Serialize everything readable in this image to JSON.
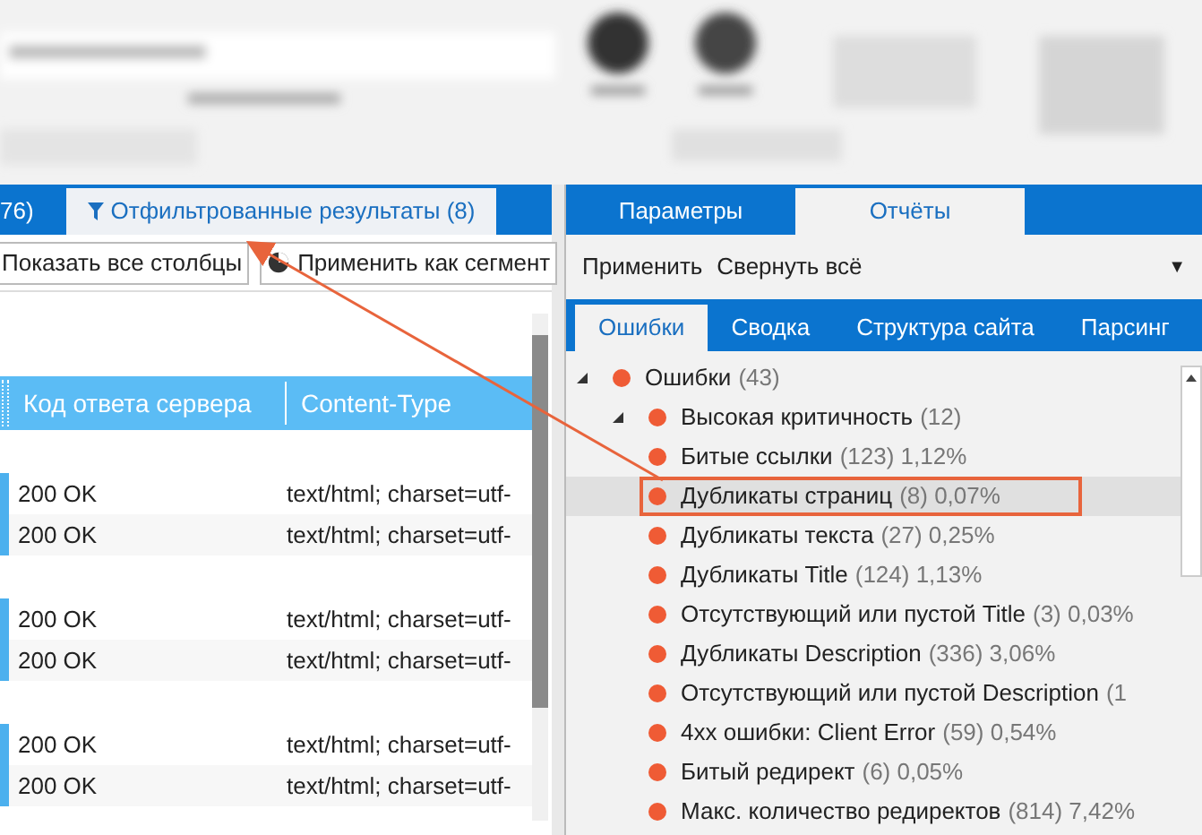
{
  "left_tabs": [
    {
      "label": "76)",
      "selected": false,
      "icon": false
    },
    {
      "label": "Отфильтрованные результаты (8)",
      "selected": true,
      "icon": true
    }
  ],
  "left_toolbar": [
    {
      "label": "Показать все столбцы",
      "icon": false
    },
    {
      "label": "Применить как сегмент",
      "icon": true
    }
  ],
  "table": {
    "columns": [
      "Код ответа сервера",
      "Content-Type"
    ],
    "groups": [
      [
        [
          "200 OK",
          "text/html; charset=utf-"
        ],
        [
          "200 OK",
          "text/html; charset=utf-"
        ]
      ],
      [
        [
          "200 OK",
          "text/html; charset=utf-"
        ],
        [
          "200 OK",
          "text/html; charset=utf-"
        ]
      ],
      [
        [
          "200 OK",
          "text/html; charset=utf-"
        ],
        [
          "200 OK",
          "text/html; charset=utf-"
        ]
      ]
    ]
  },
  "right_tabs": [
    {
      "label": "Параметры",
      "selected": false
    },
    {
      "label": "Отчёты",
      "selected": true
    }
  ],
  "right_toolbar": {
    "actions": [
      "Применить",
      "Свернуть всё"
    ],
    "menu": "▼"
  },
  "report_tabs": [
    {
      "label": "Ошибки",
      "selected": true
    },
    {
      "label": "Сводка",
      "selected": false
    },
    {
      "label": "Структура сайта",
      "selected": false
    },
    {
      "label": "Парсинг",
      "selected": false
    }
  ],
  "tree": [
    {
      "label": "Ошибки",
      "count": "(43)",
      "selected": false,
      "expanded": true,
      "children": [
        {
          "label": "Высокая критичность",
          "count": "(12)",
          "selected": false,
          "expanded": true,
          "children": [
            {
              "label": "Битые ссылки",
              "count": "(123) 1,12%",
              "selected": false
            },
            {
              "label": "Дубликаты страниц",
              "count": "(8) 0,07%",
              "selected": true
            },
            {
              "label": "Дубликаты текста",
              "count": "(27) 0,25%",
              "selected": false
            },
            {
              "label": "Дубликаты Title",
              "count": "(124) 1,13%",
              "selected": false
            },
            {
              "label": "Отсутствующий или пустой Title",
              "count": "(3) 0,03%",
              "selected": false
            },
            {
              "label": "Дубликаты Description",
              "count": "(336) 3,06%",
              "selected": false
            },
            {
              "label": "Отсутствующий или пустой Description",
              "count": "(1",
              "selected": false
            },
            {
              "label": "4xx ошибки: Client Error",
              "count": "(59) 0,54%",
              "selected": false
            },
            {
              "label": "Битый редирект",
              "count": "(6) 0,05%",
              "selected": false
            },
            {
              "label": "Макс. количество редиректов",
              "count": "(814) 7,42%",
              "selected": false
            }
          ]
        }
      ]
    }
  ]
}
